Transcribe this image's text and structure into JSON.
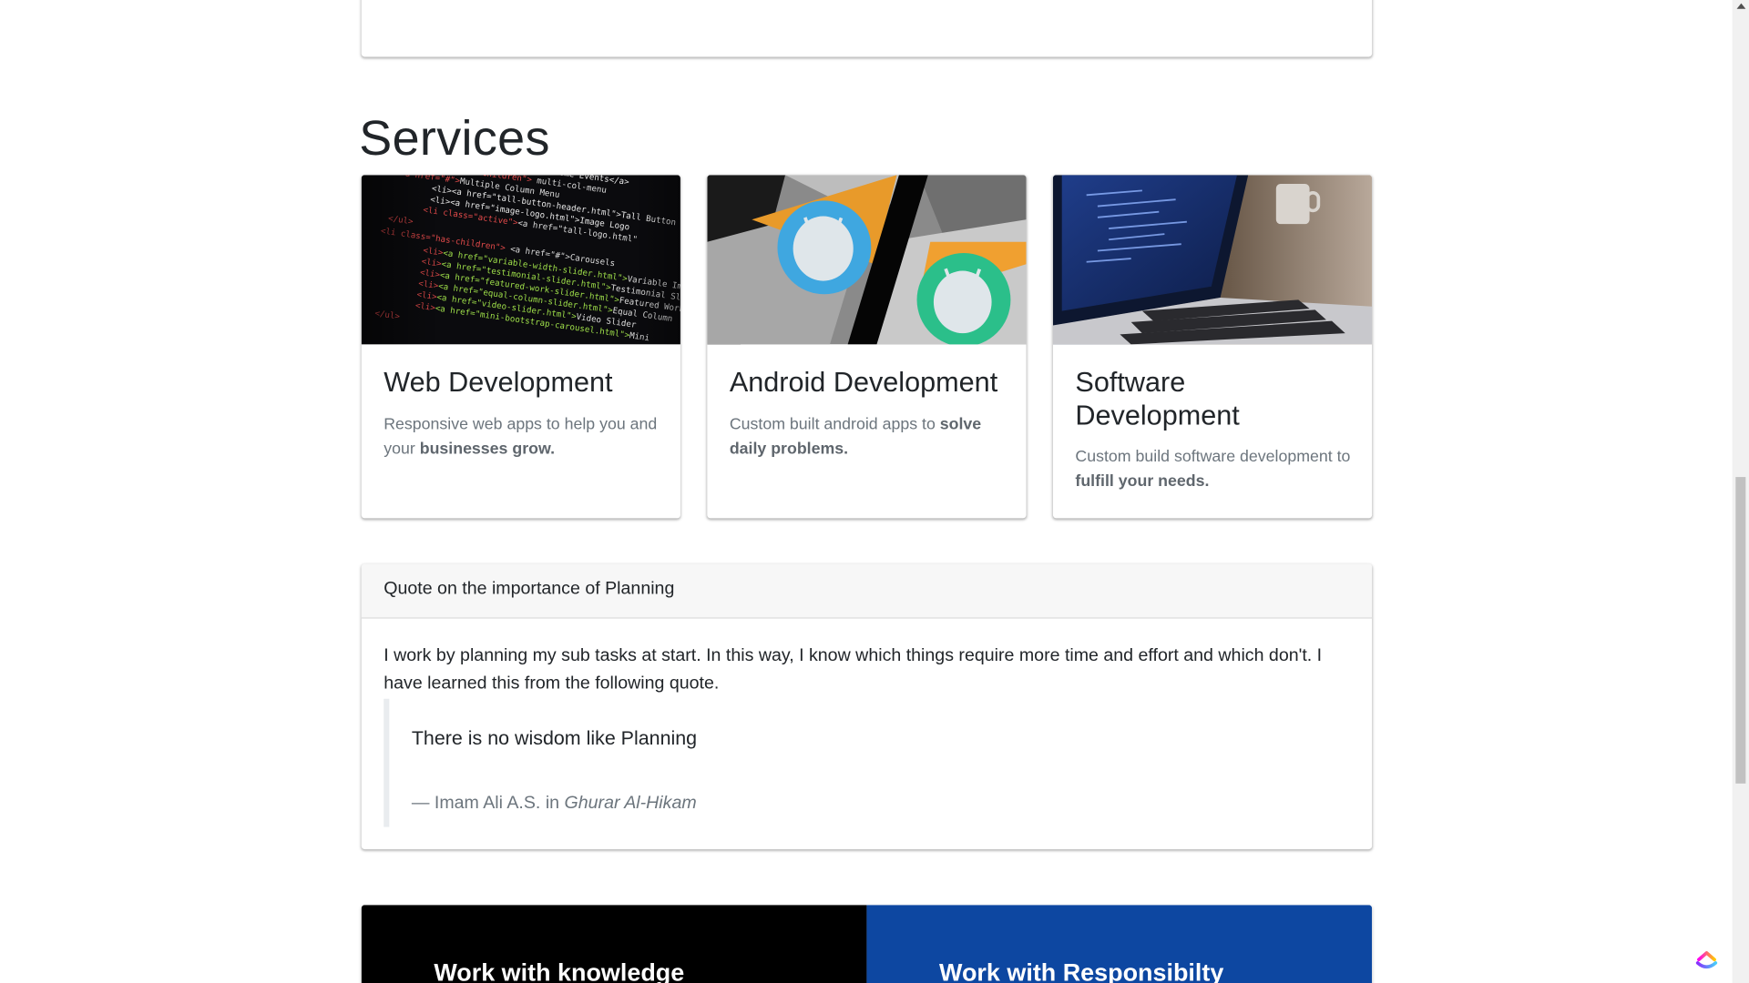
{
  "services": {
    "title": "Services",
    "cards": [
      {
        "title": "Web Development",
        "desc_plain": "Responsive web apps to help you and your ",
        "desc_bold": "businesses grow.",
        "image": "code-screen-photo"
      },
      {
        "title": "Android Development",
        "desc_plain": "Custom built android apps to ",
        "desc_bold": "solve daily problems.",
        "image": "android-marshmallow-photo"
      },
      {
        "title": "Software Development",
        "desc_plain": "Custom build software development to ",
        "desc_bold": "fulfill your needs.",
        "image": "laptop-code-photo"
      }
    ]
  },
  "quote": {
    "header": "Quote on the importance of Planning",
    "text": "I work by planning my sub tasks at start. In this way, I know which things require more time and effort and which don't. I have learned this from the following quote.",
    "blockquote": "There is no wisdom like Planning",
    "attribution": "— Imam Ali A.S. in ",
    "source": "Ghurar Al-Hikam"
  },
  "banner": {
    "left_title": "Work with knowledge",
    "right_title": "Work with Responsibilty",
    "left_color": "#000000",
    "right_color": "#0d47a1"
  },
  "icons": {
    "floating": "clickup-logo-icon"
  }
}
